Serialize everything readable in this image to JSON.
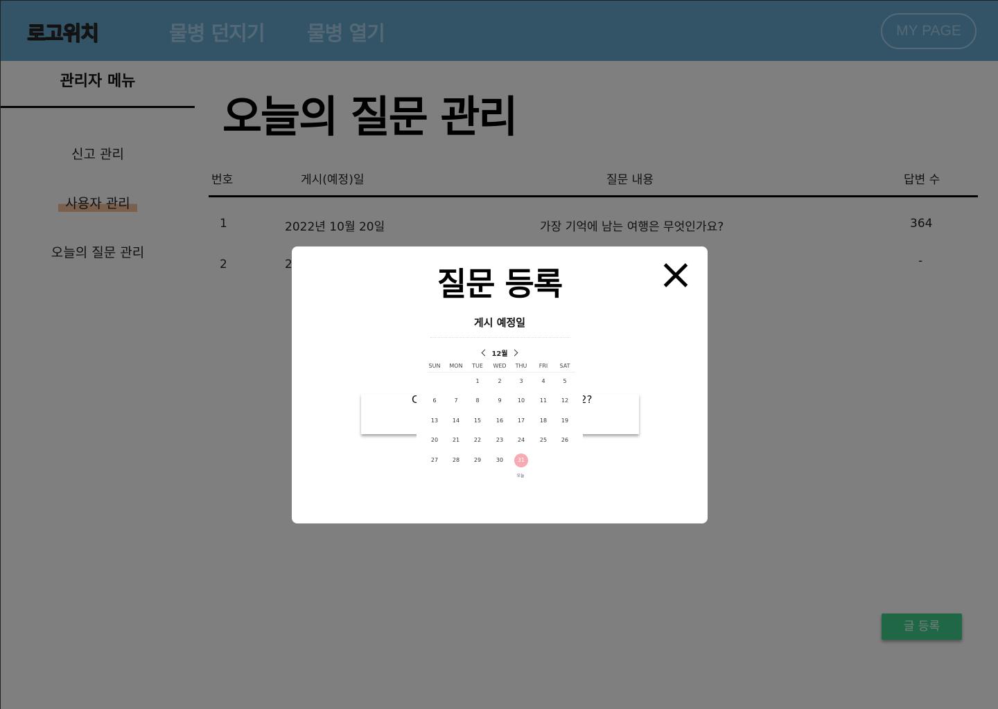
{
  "header": {
    "logo": "로고위치",
    "nav": [
      "물병 던지기",
      "물병 열기"
    ],
    "mypage_label": "MY PAGE"
  },
  "sidebar": {
    "title": "관리자 메뉴",
    "items": [
      {
        "label": "신고 관리"
      },
      {
        "label": "사용자 관리"
      },
      {
        "label": "오늘의 질문 관리"
      }
    ]
  },
  "main": {
    "title": "오늘의 질문 관리",
    "table": {
      "columns": [
        "번호",
        "게시(예정)일",
        "질문 내용",
        "답변 수"
      ],
      "rows": [
        {
          "no": "1",
          "date": "2022년 10월 20일",
          "question": "가장 기억에 남는 여행은 무엇인가요?",
          "answers": "364"
        },
        {
          "no": "2",
          "date": "2",
          "question": "",
          "answers": "-"
        }
      ]
    },
    "submit_label": "글 등록"
  },
  "modal": {
    "title": "질문 등록",
    "date_label": "게시 예정일",
    "question_left_fragment": "C",
    "question_right_fragment": "2?",
    "calendar": {
      "month": "12월",
      "weekdays": [
        "SUN",
        "MON",
        "TUE",
        "WED",
        "THU",
        "FRI",
        "SAT"
      ],
      "weeks": [
        [
          "",
          "",
          "1",
          "2",
          "3",
          "4",
          "5"
        ],
        [
          "6",
          "7",
          "8",
          "9",
          "10",
          "11",
          "12"
        ],
        [
          "13",
          "14",
          "15",
          "16",
          "17",
          "18",
          "19"
        ],
        [
          "20",
          "21",
          "22",
          "23",
          "24",
          "25",
          "26"
        ],
        [
          "27",
          "28",
          "29",
          "30",
          "31",
          "",
          ""
        ]
      ],
      "selected_day": "31",
      "today_label": "오늘"
    }
  },
  "colors": {
    "header_bg": "#66a9cf",
    "accent_green": "#3fcf8a",
    "highlight": "#f6c09d",
    "today_pink": "#f7aab4",
    "overlay": "rgba(0,0,0,0.5)"
  }
}
